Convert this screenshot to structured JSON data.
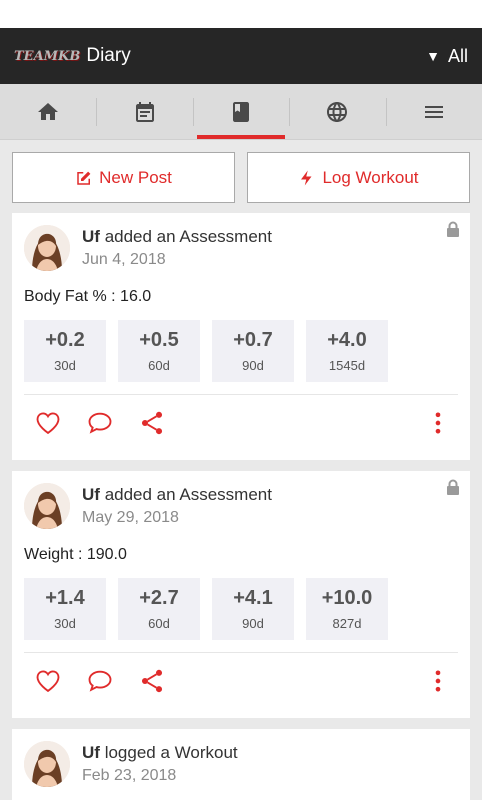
{
  "app_bar": {
    "logo_text": "TEAMKB",
    "title": "Diary",
    "filter_label": "All",
    "filter_caret": "▼"
  },
  "tabs": [
    {
      "name": "home",
      "icon": "home-icon"
    },
    {
      "name": "calendar",
      "icon": "calendar-icon"
    },
    {
      "name": "diary",
      "icon": "book-icon",
      "active": true
    },
    {
      "name": "community",
      "icon": "globe-icon"
    },
    {
      "name": "menu",
      "icon": "menu-icon"
    }
  ],
  "actions": {
    "new_post": "New Post",
    "log_workout": "Log Workout"
  },
  "accent_color": "#e02b2b",
  "posts": [
    {
      "user": "Uf",
      "action": "added an Assessment",
      "date": "Jun 4, 2018",
      "metric": "Body Fat % : 16.0",
      "changes": [
        {
          "value": "+0.2",
          "period": "30d"
        },
        {
          "value": "+0.5",
          "period": "60d"
        },
        {
          "value": "+0.7",
          "period": "90d"
        },
        {
          "value": "+4.0",
          "period": "1545d"
        }
      ]
    },
    {
      "user": "Uf",
      "action": "added an Assessment",
      "date": "May 29, 2018",
      "metric": "Weight : 190.0",
      "changes": [
        {
          "value": "+1.4",
          "period": "30d"
        },
        {
          "value": "+2.7",
          "period": "60d"
        },
        {
          "value": "+4.1",
          "period": "90d"
        },
        {
          "value": "+10.0",
          "period": "827d"
        }
      ]
    },
    {
      "user": "Uf",
      "action": "logged a Workout",
      "date": "Feb 23, 2018"
    }
  ]
}
